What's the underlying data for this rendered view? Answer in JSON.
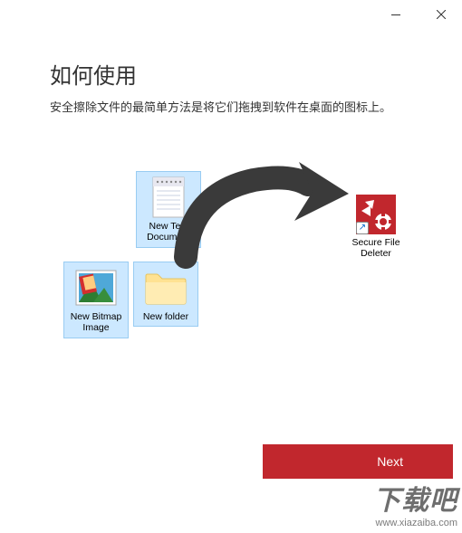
{
  "window": {
    "title": ""
  },
  "heading": "如何使用",
  "description": "安全擦除文件的最简单方法是将它们拖拽到软件在桌面的图标上。",
  "files": {
    "text_doc": "New Text Document",
    "bitmap": "New Bitmap Image",
    "folder": "New folder"
  },
  "destination": {
    "label": "Secure File Deleter"
  },
  "buttons": {
    "next": "Next"
  },
  "watermark": {
    "text": "下载吧",
    "url": "www.xiazaiba.com"
  }
}
